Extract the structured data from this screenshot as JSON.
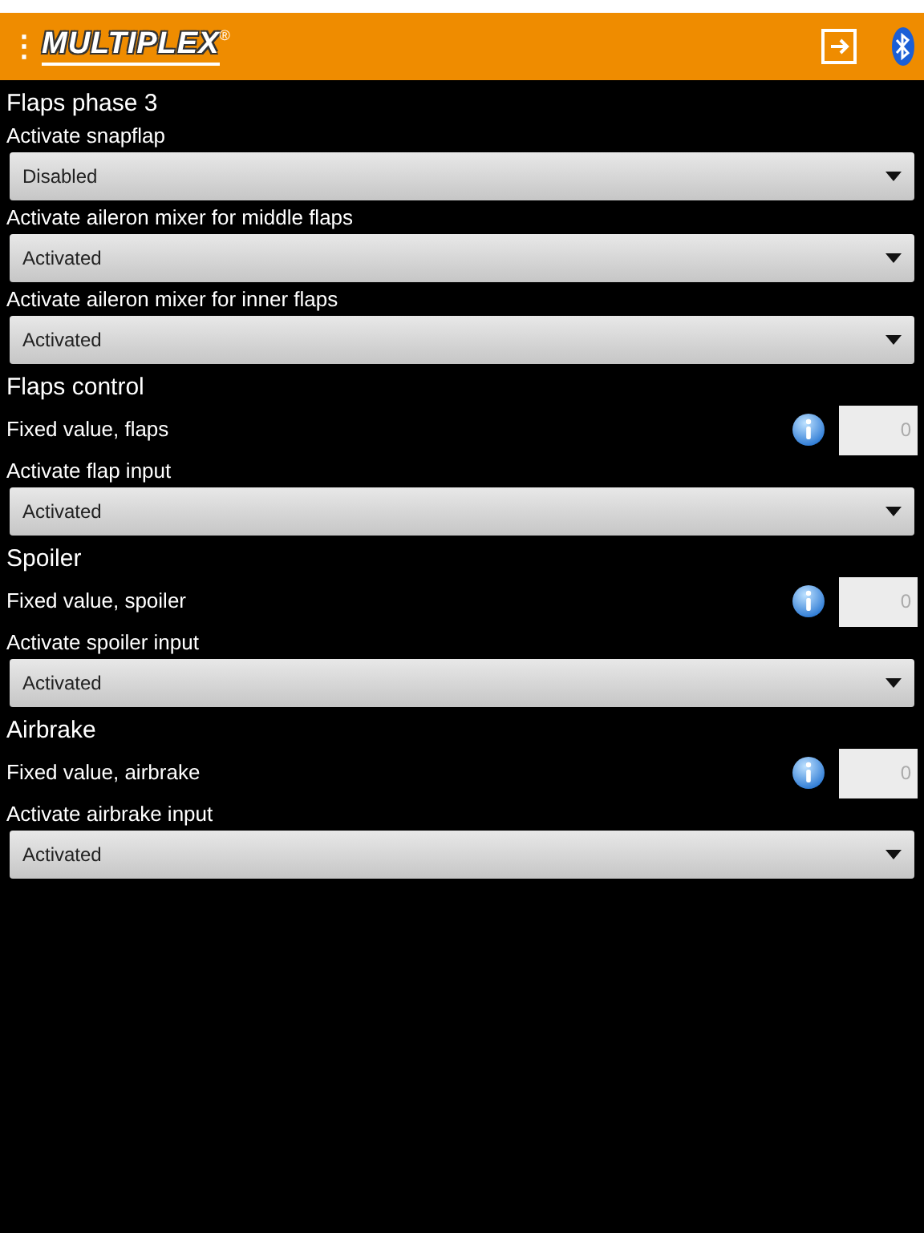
{
  "header": {
    "menu": "⋮",
    "logo": "MULTIPLEX",
    "logo_mark": "®"
  },
  "items": [
    {
      "kind": "section",
      "label": "Flaps phase 3"
    },
    {
      "kind": "select",
      "label": "Activate snapflap",
      "value": "Disabled"
    },
    {
      "kind": "select",
      "label": "Activate aileron mixer for middle flaps",
      "value": "Activated"
    },
    {
      "kind": "select",
      "label": "Activate aileron mixer for inner flaps",
      "value": "Activated"
    },
    {
      "kind": "section",
      "label": "Flaps control"
    },
    {
      "kind": "number",
      "label": "Fixed value, flaps",
      "value": "0"
    },
    {
      "kind": "select",
      "label": "Activate flap input",
      "value": "Activated"
    },
    {
      "kind": "section",
      "label": "Spoiler"
    },
    {
      "kind": "number",
      "label": "Fixed value, spoiler",
      "value": "0"
    },
    {
      "kind": "select",
      "label": "Activate spoiler input",
      "value": "Activated"
    },
    {
      "kind": "section",
      "label": "Airbrake"
    },
    {
      "kind": "number",
      "label": "Fixed value, airbrake",
      "value": "0"
    },
    {
      "kind": "select",
      "label": "Activate airbrake input",
      "value": "Activated"
    }
  ]
}
